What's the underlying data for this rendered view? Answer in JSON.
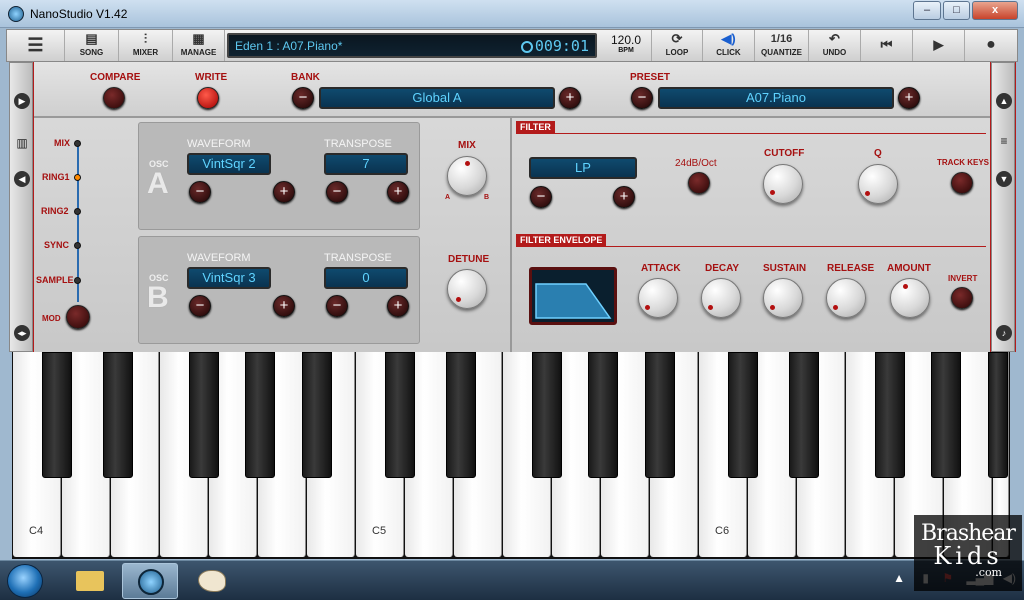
{
  "window": {
    "title": "NanoStudio V1.42",
    "controls": [
      "–",
      "□",
      "x"
    ]
  },
  "toolbar": {
    "menu_icon": "menu-icon",
    "song": "SONG",
    "mixer": "MIXER",
    "manage": "MANAGE",
    "song_name": "Eden 1 : A07.Piano*",
    "time": "009:01",
    "bpm_value": "120.0",
    "bpm_label": "BPM",
    "loop": "LOOP",
    "click": "CLICK",
    "quantize_value": "1/16",
    "quantize_label": "QUANTIZE",
    "undo": "UNDO",
    "icons": {
      "rewind": "skip-back-icon",
      "play": "play-icon",
      "record": "record-icon"
    }
  },
  "top": {
    "compare": "COMPARE",
    "write": "WRITE",
    "bank_label": "BANK",
    "bank_value": "Global A",
    "preset_label": "PRESET",
    "preset_value": "A07.Piano"
  },
  "routing": {
    "items": [
      "MIX",
      "RING1",
      "RING2",
      "SYNC",
      "SAMPLE",
      "MOD"
    ],
    "active": "RING1"
  },
  "osc_a": {
    "tag": "OSC",
    "letter": "A",
    "waveform_label": "WAVEFORM",
    "waveform_value": "VintSqr 2",
    "transpose_label": "TRANSPOSE",
    "transpose_value": "7"
  },
  "osc_b": {
    "tag": "OSC",
    "letter": "B",
    "waveform_label": "WAVEFORM",
    "waveform_value": "VintSqr 3",
    "transpose_label": "TRANSPOSE",
    "transpose_value": "0"
  },
  "mix": {
    "label": "MIX",
    "left": "A",
    "right": "B"
  },
  "detune": {
    "label": "DETUNE"
  },
  "filter": {
    "header": "FILTER",
    "type_value": "LP",
    "slope_label": "24dB/Oct",
    "cutoff_label": "CUTOFF",
    "q_label": "Q",
    "track_keys_label": "TRACK KEYS"
  },
  "filter_env": {
    "header": "FILTER ENVELOPE",
    "attack": "ATTACK",
    "decay": "DECAY",
    "sustain": "SUSTAIN",
    "release": "RELEASE",
    "amount": "AMOUNT",
    "invert": "INVERT"
  },
  "keyboard": {
    "labels": [
      "C4",
      "C5",
      "C6"
    ]
  },
  "watermark": {
    "line1": "Brashear",
    "line2": "Kids",
    "line3": ".com"
  },
  "colors": {
    "accent": "#b31b1b",
    "lcd_text": "#5ec8f0",
    "display_bg": "#0f4a6e"
  }
}
